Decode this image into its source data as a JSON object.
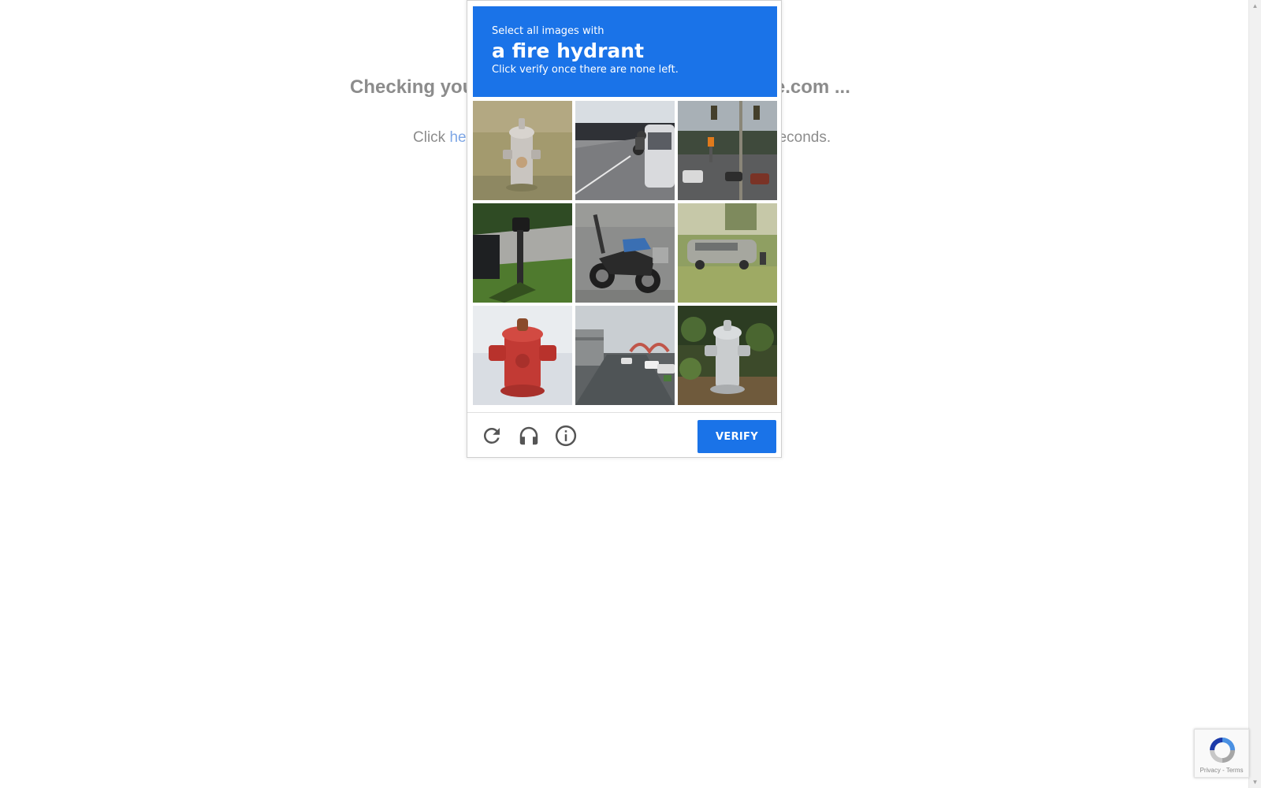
{
  "background": {
    "heading_left": "Checking you",
    "heading_right": "aggle.com ...",
    "line_prefix": "Click ",
    "line_link": "he",
    "line_suffix": "econds."
  },
  "captcha": {
    "instruction": "Select all images with",
    "target": "a fire hydrant",
    "subtext": "Click verify once there are none left.",
    "tiles": [
      {
        "subject": "silver fire hydrant on grass"
      },
      {
        "subject": "street with car and cyclist"
      },
      {
        "subject": "road with traffic lights and cars"
      },
      {
        "subject": "mailbox and trash bin on lawn"
      },
      {
        "subject": "parked motorcycle"
      },
      {
        "subject": "van on grass"
      },
      {
        "subject": "red fire hydrant"
      },
      {
        "subject": "road with bridge and cars"
      },
      {
        "subject": "silver fire hydrant in leaves"
      }
    ],
    "reload_icon": "reload-icon",
    "audio_icon": "headphones-icon",
    "info_icon": "info-icon",
    "verify_label": "VERIFY",
    "accent_color": "#1a73e8"
  },
  "badge": {
    "terms": "Privacy - Terms"
  }
}
